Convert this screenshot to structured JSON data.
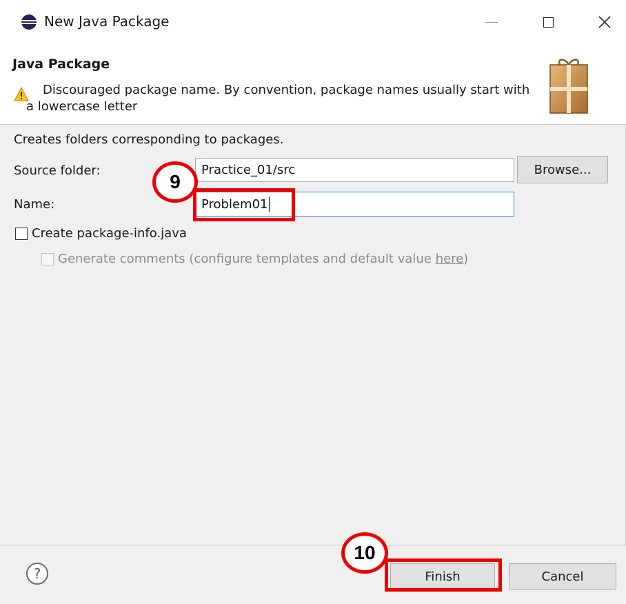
{
  "window": {
    "title": "New Java Package",
    "close_glyph": "✕"
  },
  "banner": {
    "title": "Java Package",
    "message": "Discouraged package name. By convention, package names usually start with a lowercase letter"
  },
  "form": {
    "description": "Creates folders corresponding to packages.",
    "source_folder_label": "Source folder:",
    "source_folder_value": "Practice_01/src",
    "browse_label": "Browse...",
    "name_label": "Name:",
    "name_value": "Problem01",
    "create_package_info_label": "Create package-info.java",
    "create_package_info_checked": false,
    "generate_comments_prefix": "Generate comments (configure templates and default value ",
    "generate_comments_link": "here",
    "generate_comments_suffix": ")",
    "generate_comments_enabled": false
  },
  "footer": {
    "help_glyph": "?",
    "finish_label": "Finish",
    "cancel_label": "Cancel"
  },
  "annotations": {
    "step_name": "9",
    "step_finish": "10",
    "highlight_color": "#ee0000"
  },
  "icons": {
    "app": "eclipse-icon",
    "warning": "warning-icon",
    "wizard": "package-gift-icon",
    "help": "help-icon"
  }
}
